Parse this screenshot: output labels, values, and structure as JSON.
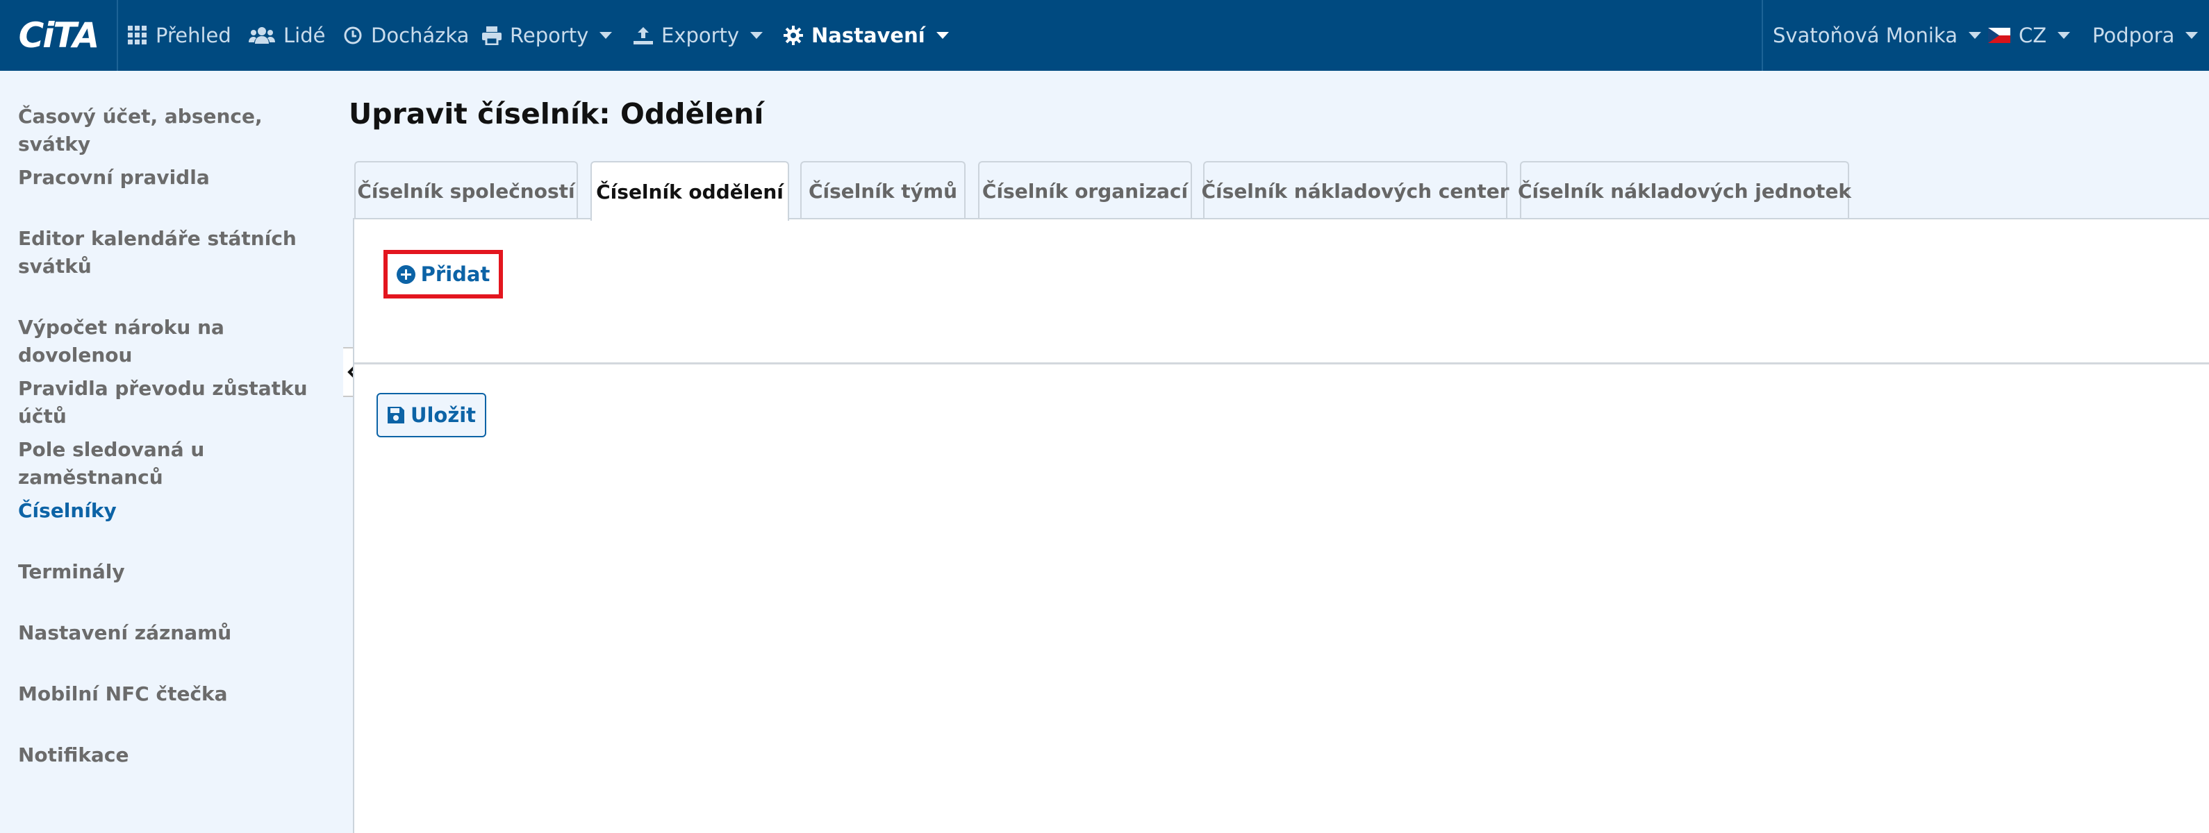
{
  "app": {
    "logo_text": "CiTA"
  },
  "nav": {
    "items": [
      {
        "label": "Přehled",
        "icon": "grid-icon"
      },
      {
        "label": "Lidé",
        "icon": "users-icon"
      },
      {
        "label": "Docházka",
        "icon": "clock-icon"
      },
      {
        "label": "Reporty",
        "icon": "printer-icon"
      },
      {
        "label": "Exporty",
        "icon": "export-icon"
      },
      {
        "label": "Nastavení",
        "icon": "gear-icon",
        "active": true
      }
    ],
    "user": "Svatoňová Monika",
    "language": "CZ",
    "support": "Podpora"
  },
  "sidebar": {
    "items": [
      {
        "label": "Časový účet, absence, svátky"
      },
      {
        "label": "Pracovní pravidla"
      },
      {
        "label": "Editor kalendáře státních svátků"
      },
      {
        "label": "Výpočet nároku na dovolenou"
      },
      {
        "label": "Pravidla převodu zůstatku účtů"
      },
      {
        "label": "Pole sledovaná u zaměstnanců"
      },
      {
        "label": "Číselníky",
        "active": true
      },
      {
        "label": "Terminály"
      },
      {
        "label": "Nastavení záznamů"
      },
      {
        "label": "Mobilní NFC čtečka"
      },
      {
        "label": "Notifikace"
      }
    ]
  },
  "main": {
    "title": "Upravit číselník: Oddělení",
    "tabs": [
      {
        "label": "Číselník společností"
      },
      {
        "label": "Číselník oddělení",
        "active": true
      },
      {
        "label": "Číselník týmů"
      },
      {
        "label": "Číselník organizací"
      },
      {
        "label": "Číselník nákladových center"
      },
      {
        "label": "Číselník nákladových jednotek"
      }
    ],
    "add_label": "Přidat",
    "save_label": "Uložit"
  },
  "colors": {
    "nav_bg": "#004a80",
    "page_bg": "#eef5fd",
    "accent": "#0c63a6",
    "highlight": "#e3161f"
  }
}
